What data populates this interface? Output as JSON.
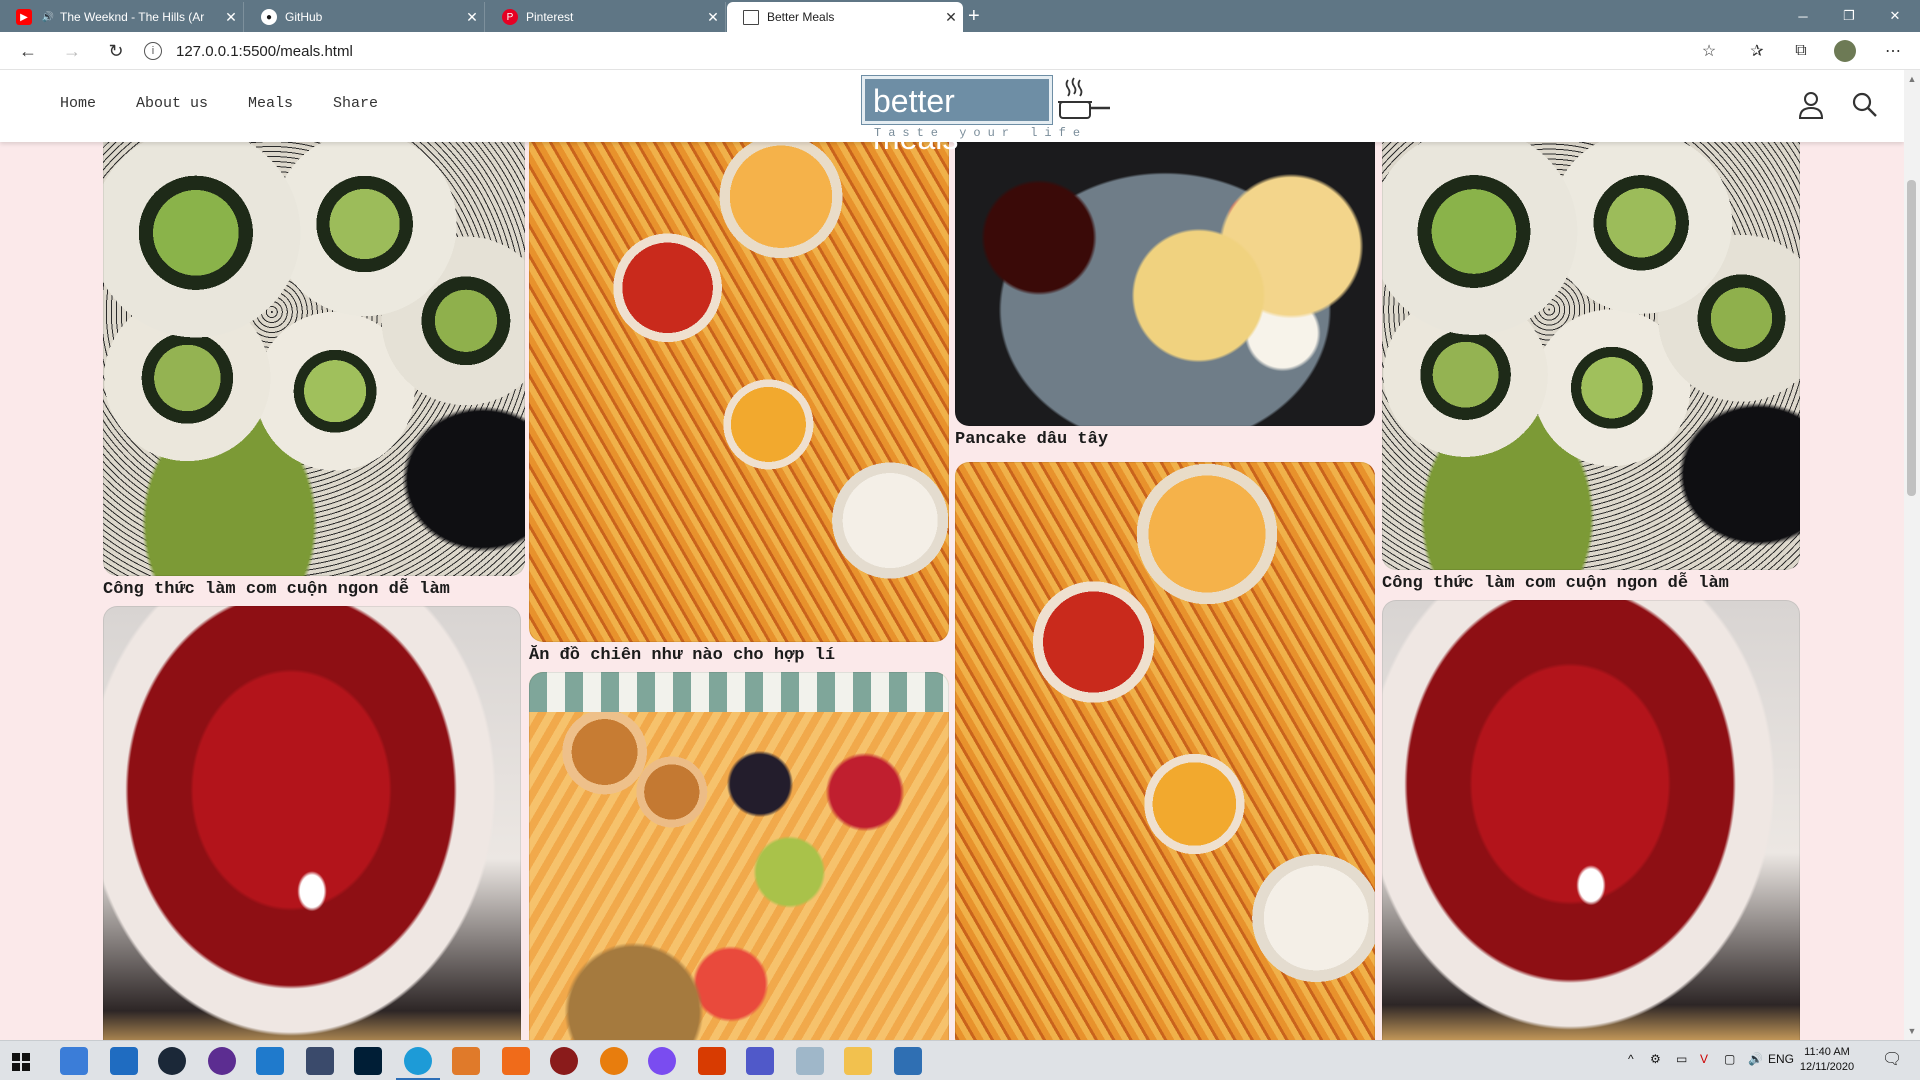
{
  "browser": {
    "tabs": [
      {
        "title": "The Weeknd - The Hills (Ar",
        "icon": "youtube-icon",
        "color": "#ff0000"
      },
      {
        "title": "GitHub",
        "icon": "github-icon",
        "color": "#181717"
      },
      {
        "title": "Pinterest",
        "icon": "pinterest-icon",
        "color": "#e60023"
      },
      {
        "title": "Better Meals",
        "icon": "page-icon",
        "color": "#ffffff"
      }
    ],
    "url": "127.0.0.1:5500/meals.html"
  },
  "site": {
    "menu": [
      "Home",
      "About us",
      "Meals",
      "Share"
    ],
    "logo_text": "better meals",
    "tagline": "Taste your life"
  },
  "meals": {
    "col1": [
      "Công thức làm com cuộn ngon dễ làm"
    ],
    "col2": [
      "Ăn đồ chiên như nào cho hợp lí"
    ],
    "col3": [
      "Pancake dâu tây"
    ],
    "col4": [
      "Công thức làm com cuộn ngon dễ làm"
    ]
  },
  "taskbar": {
    "lang": "ENG",
    "time": "11:40 AM",
    "date": "12/11/2020"
  },
  "colors": {
    "page_bg": "#fbe9ea",
    "logo_bg": "#6e8ea5",
    "tabbar": "#5f7685"
  }
}
